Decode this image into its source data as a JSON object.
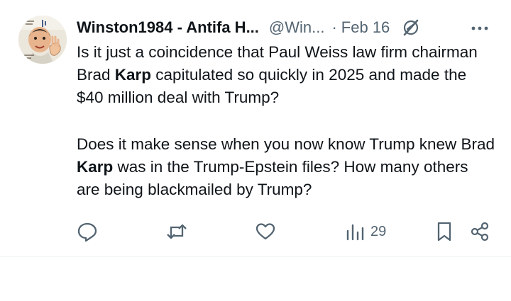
{
  "post": {
    "display_name": "Winston1984 - Antifa H...",
    "handle": "@Win...",
    "separator": "·",
    "date": "Feb 16",
    "paragraphs": [
      {
        "line1_pre": "Is it just a coincidence that Paul Weiss law firm chairman Brad ",
        "line1_bold": "Karp",
        "line1_post": " capitulated so quickly in 2025 and made the $40 million deal with Trump?"
      },
      {
        "line1_pre": "Does it make sense when you now know Trump knew Brad ",
        "line1_bold": "Karp",
        "line1_post": " was in the Trump-Epstein files? How many others are being blackmailed by Trump?"
      }
    ]
  },
  "actions": {
    "reply_icon": "reply-icon",
    "repost_icon": "repost-icon",
    "like_icon": "like-icon",
    "views_icon": "views-icon",
    "views_count": "29",
    "bookmark_icon": "bookmark-icon",
    "share_icon": "share-icon"
  },
  "colors": {
    "text": "#0f1419",
    "secondary": "#536471",
    "divider": "#eff3f4"
  }
}
